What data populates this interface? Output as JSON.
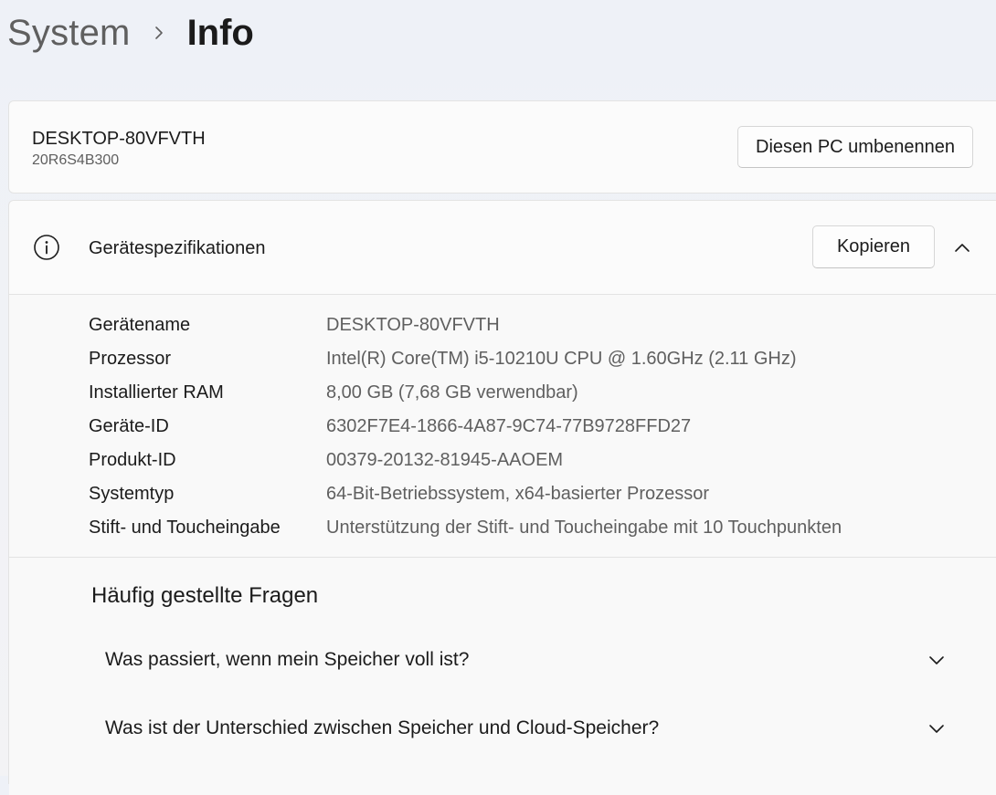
{
  "breadcrumb": {
    "parent": "System",
    "separator_icon": "chevron-right-icon",
    "current": "Info"
  },
  "pc_card": {
    "device_name": "DESKTOP-80VFVTH",
    "model": "20R6S4B300",
    "rename_button": "Diesen PC umbenennen"
  },
  "specs": {
    "icon": "info-icon",
    "title": "Gerätespezifikationen",
    "copy_button": "Kopieren",
    "collapse_icon": "chevron-up-icon",
    "rows": [
      {
        "label": "Gerätename",
        "value": "DESKTOP-80VFVTH"
      },
      {
        "label": "Prozessor",
        "value": "Intel(R) Core(TM) i5-10210U CPU @ 1.60GHz (2.11 GHz)"
      },
      {
        "label": "Installierter RAM",
        "value": "8,00 GB (7,68 GB verwendbar)"
      },
      {
        "label": "Geräte-ID",
        "value": "6302F7E4-1866-4A87-9C74-77B9728FFD27"
      },
      {
        "label": "Produkt-ID",
        "value": "00379-20132-81945-AAOEM"
      },
      {
        "label": "Systemtyp",
        "value": "64-Bit-Betriebssystem, x64-basierter Prozessor"
      },
      {
        "label": "Stift- und Toucheingabe",
        "value": "Unterstützung der Stift- und Toucheingabe mit 10 Touchpunkten"
      }
    ]
  },
  "faq": {
    "title": "Häufig gestellte Fragen",
    "items": [
      {
        "question": "Was passiert, wenn mein Speicher voll ist?"
      },
      {
        "question": "Was ist der Unterschied zwischen Speicher und Cloud-Speicher?"
      }
    ]
  },
  "colors": {
    "text_primary": "#1b1b1b",
    "text_secondary": "#5f5f5f",
    "card_bg": "#fbfbfb",
    "border": "#e3e3e3"
  }
}
